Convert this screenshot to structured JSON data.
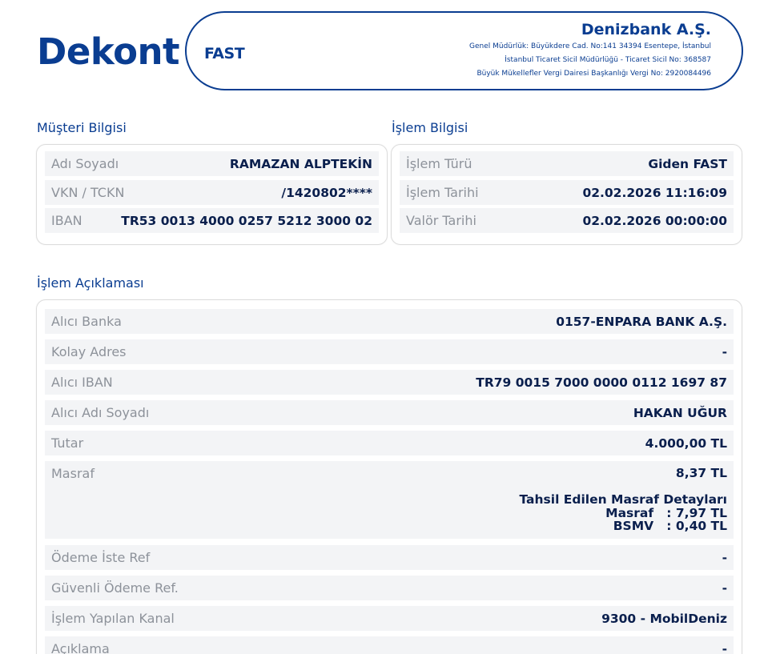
{
  "header": {
    "title": "Dekont",
    "transaction_kind": "FAST",
    "bank_name": "Denizbank A.Ş.",
    "bank_lines": [
      "Genel Müdürlük: Büyükdere Cad. No:141 34394 Esentepe, İstanbul",
      "İstanbul Ticaret Sicil Müdürlüğü - Ticaret Sicil No: 368587",
      "Büyük Mükellefler Vergi Dairesi Başkanlığı Vergi No: 2920084496"
    ]
  },
  "customer": {
    "title": "Müşteri Bilgisi",
    "rows": [
      {
        "label": "Adı Soyadı",
        "value": "RAMAZAN ALPTEKİN"
      },
      {
        "label": "VKN / TCKN",
        "value": "/1420802****"
      },
      {
        "label": "IBAN",
        "value": "TR53 0013 4000 0257 5212 3000 02"
      }
    ]
  },
  "transaction": {
    "title": "İşlem Bilgisi",
    "rows": [
      {
        "label": "İşlem Türü",
        "value": "Giden FAST"
      },
      {
        "label": "İşlem Tarihi",
        "value": "02.02.2026 11:16:09"
      },
      {
        "label": "Valör Tarihi",
        "value": "02.02.2026 00:00:00"
      }
    ]
  },
  "description": {
    "title": "İşlem Açıklaması",
    "rows_top": [
      {
        "label": "Alıcı Banka",
        "value": "0157-ENPARA BANK A.Ş."
      },
      {
        "label": "Kolay Adres",
        "value": "-"
      },
      {
        "label": "Alıcı IBAN",
        "value": "TR79 0015 7000 0000 0112 1697 87"
      },
      {
        "label": "Alıcı Adı Soyadı",
        "value": "HAKAN UĞUR"
      },
      {
        "label": "Tutar",
        "value": "4.000,00 TL"
      }
    ],
    "fee": {
      "label": "Masraf",
      "value": "8,37 TL",
      "detail_title": "Tahsil Edilen Masraf Detayları",
      "detail_lines": [
        "Masraf   : 7,97 TL",
        "BSMV   : 0,40 TL"
      ]
    },
    "rows_bottom": [
      {
        "label": "Ödeme İste Ref",
        "value": "-"
      },
      {
        "label": "Güvenli Ödeme Ref.",
        "value": "-"
      },
      {
        "label": "İşlem Yapılan Kanal",
        "value": "9300 - MobilDeniz"
      },
      {
        "label": "Açıklama",
        "value": "-"
      }
    ]
  }
}
